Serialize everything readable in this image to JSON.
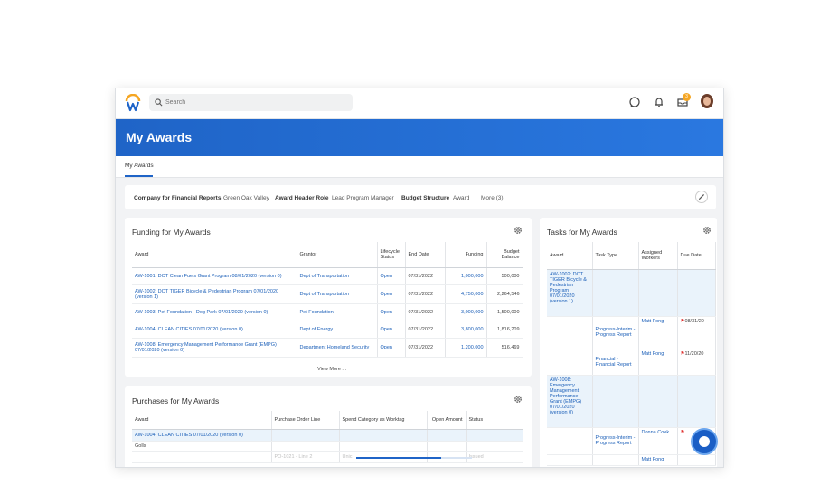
{
  "search": {
    "placeholder": "Search"
  },
  "notifications": {
    "inbox_count": "3"
  },
  "page": {
    "title": "My Awards"
  },
  "tabs": [
    {
      "label": "My Awards"
    }
  ],
  "filters": [
    {
      "key": "Company for Financial Reports",
      "value": "Green Oak Valley"
    },
    {
      "key": "Award Header Role",
      "value": "Lead Program Manager"
    },
    {
      "key": "Budget Structure",
      "value": "Award"
    }
  ],
  "filters_more": "More (3)",
  "funding": {
    "title": "Funding for My Awards",
    "columns": [
      "Award",
      "Grantor",
      "Lifecycle Status",
      "End Date",
      "Funding",
      "Budget Balance"
    ],
    "rows": [
      [
        "AW-1001: DOT Clean Fuels Grant Program 08/01/2020 (version 0)",
        "Dept of Transportation",
        "Open",
        "07/31/2022",
        "1,000,000",
        "500,000"
      ],
      [
        "AW-1002: DOT TIGER Bicycle & Pedestrian Program 07/01/2020 (version 1)",
        "Dept of Transportation",
        "Open",
        "07/31/2022",
        "4,750,000",
        "2,264,546"
      ],
      [
        "AW-1003: Pet Foundation - Dog Park 07/01/2020 (version 0)",
        "Pet Foundation",
        "Open",
        "07/31/2022",
        "3,000,000",
        "1,500,000"
      ],
      [
        "AW-1004: CLEAN CITIES 07/01/2020 (version 0)",
        "Dept of Energy",
        "Open",
        "07/31/2022",
        "3,800,000",
        "1,816,209"
      ],
      [
        "AW-1008: Emergency Management Performance Grant (EMPG) 07/01/2020 (version 0)",
        "Department Homeland Security",
        "Open",
        "07/31/2022",
        "1,200,000",
        "516,469"
      ]
    ],
    "view_more": "View More ..."
  },
  "purchases": {
    "title": "Purchases for My Awards",
    "columns": [
      "Award",
      "Purchase Order Line",
      "Spend Category as Worktag",
      "Open Amount",
      "Status"
    ],
    "rows": [
      [
        "AW-1004: CLEAN CITIES 07/01/2020 (version 0)",
        "",
        "",
        "",
        ""
      ],
      [
        "Golls",
        "",
        "",
        "",
        ""
      ],
      [
        "",
        "PO-1021 - Line 2",
        "Unic",
        "",
        "Issued"
      ]
    ]
  },
  "tasks": {
    "title": "Tasks for My Awards",
    "columns": [
      "Award",
      "Task Type",
      "Assigned Workers",
      "Due Date"
    ],
    "rows": [
      {
        "award": "AW-1002: DOT TIGER Bicycle & Pedestrian Program 07/01/2020 (version 1)",
        "task": "",
        "worker": "",
        "due": "",
        "hl": true
      },
      {
        "award": "",
        "task": "Progress-Interim - Progress Report",
        "worker": "Matt Fong",
        "due": "08/31/20",
        "hl": false
      },
      {
        "award": "",
        "task": "Financial - Financial Report",
        "worker": "Matt Fong",
        "due": "11/20/20",
        "hl": false
      },
      {
        "award": "AW-1008: Emergency Management Performance Grant (EMPG) 07/01/2020 (version 0)",
        "task": "",
        "worker": "",
        "due": "",
        "hl": true
      },
      {
        "award": "",
        "task": "Progress-Interim - Progress Report",
        "worker": "Donna Cook",
        "due": "",
        "hl": false
      },
      {
        "award": "",
        "task": "",
        "worker": "Matt Fong",
        "due": "",
        "hl": false
      }
    ]
  },
  "colors": {
    "brand_blue": "#1f64c7",
    "link": "#1b5fb8",
    "flag": "#e0302f",
    "badge": "#f5a623"
  },
  "icons": [
    "workday-logo-icon",
    "search-icon",
    "chat-icon",
    "bell-icon",
    "inbox-icon",
    "avatar",
    "pencil-icon",
    "gear-icon",
    "flag-icon",
    "assistant-icon"
  ]
}
